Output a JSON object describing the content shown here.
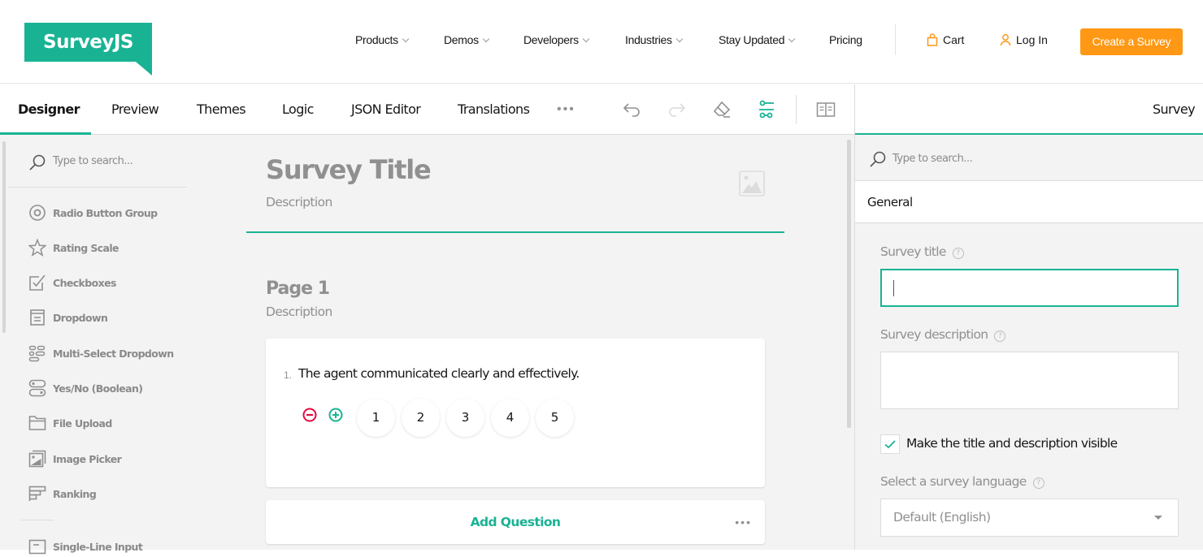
{
  "site": {
    "logo": "SurveyJS",
    "nav": [
      {
        "label": "Products",
        "has_dropdown": true
      },
      {
        "label": "Demos",
        "has_dropdown": true
      },
      {
        "label": "Developers",
        "has_dropdown": true
      },
      {
        "label": "Industries",
        "has_dropdown": true
      },
      {
        "label": "Stay Updated",
        "has_dropdown": true
      },
      {
        "label": "Pricing",
        "has_dropdown": false
      }
    ],
    "cart_label": "Cart",
    "login_label": "Log In",
    "cta_label": "Create a Survey",
    "colors": {
      "brand": "#19b394",
      "cta": "#ff9814"
    }
  },
  "creator": {
    "tabs": [
      {
        "label": "Designer",
        "active": true
      },
      {
        "label": "Preview",
        "active": false
      },
      {
        "label": "Themes",
        "active": false
      },
      {
        "label": "Logic",
        "active": false
      },
      {
        "label": "JSON Editor",
        "active": false
      },
      {
        "label": "Translations",
        "active": false
      }
    ],
    "more_tabs_label": "•••",
    "toolbar": [
      "undo-icon",
      "redo-icon",
      "eraser-icon",
      "settings-sliders-icon",
      "book-icon"
    ],
    "side_tab_label": "Survey"
  },
  "toolbox": {
    "search_placeholder": "Type to search...",
    "items": [
      {
        "label": "Radio Button Group",
        "icon": "radio-icon"
      },
      {
        "label": "Rating Scale",
        "icon": "star-icon"
      },
      {
        "label": "Checkboxes",
        "icon": "checkbox-icon"
      },
      {
        "label": "Dropdown",
        "icon": "dropdown-icon"
      },
      {
        "label": "Multi-Select Dropdown",
        "icon": "multi-select-icon"
      },
      {
        "label": "Yes/No (Boolean)",
        "icon": "boolean-icon"
      },
      {
        "label": "File Upload",
        "icon": "folder-icon"
      },
      {
        "label": "Image Picker",
        "icon": "image-picker-icon"
      },
      {
        "label": "Ranking",
        "icon": "ranking-icon"
      },
      {
        "label": "Single-Line Input",
        "icon": "text-input-icon"
      }
    ]
  },
  "survey": {
    "title": "Survey Title",
    "description": "Description",
    "page": {
      "title": "Page 1",
      "description": "Description"
    },
    "questions": [
      {
        "number": "1.",
        "title": "The agent communicated clearly and effectively.",
        "rate_values": [
          "1",
          "2",
          "3",
          "4",
          "5"
        ]
      }
    ],
    "add_question_label": "Add Question",
    "add_question_more": "•••"
  },
  "property_grid": {
    "search_placeholder": "Type to search...",
    "category": "General",
    "survey_title_label": "Survey title",
    "survey_title_value": "",
    "survey_description_label": "Survey description",
    "survey_description_value": "",
    "visible_checkbox_label": "Make the title and description visible",
    "visible_checkbox_checked": true,
    "language_label": "Select a survey language",
    "language_value": "Default (English)",
    "help_glyph": "?"
  }
}
